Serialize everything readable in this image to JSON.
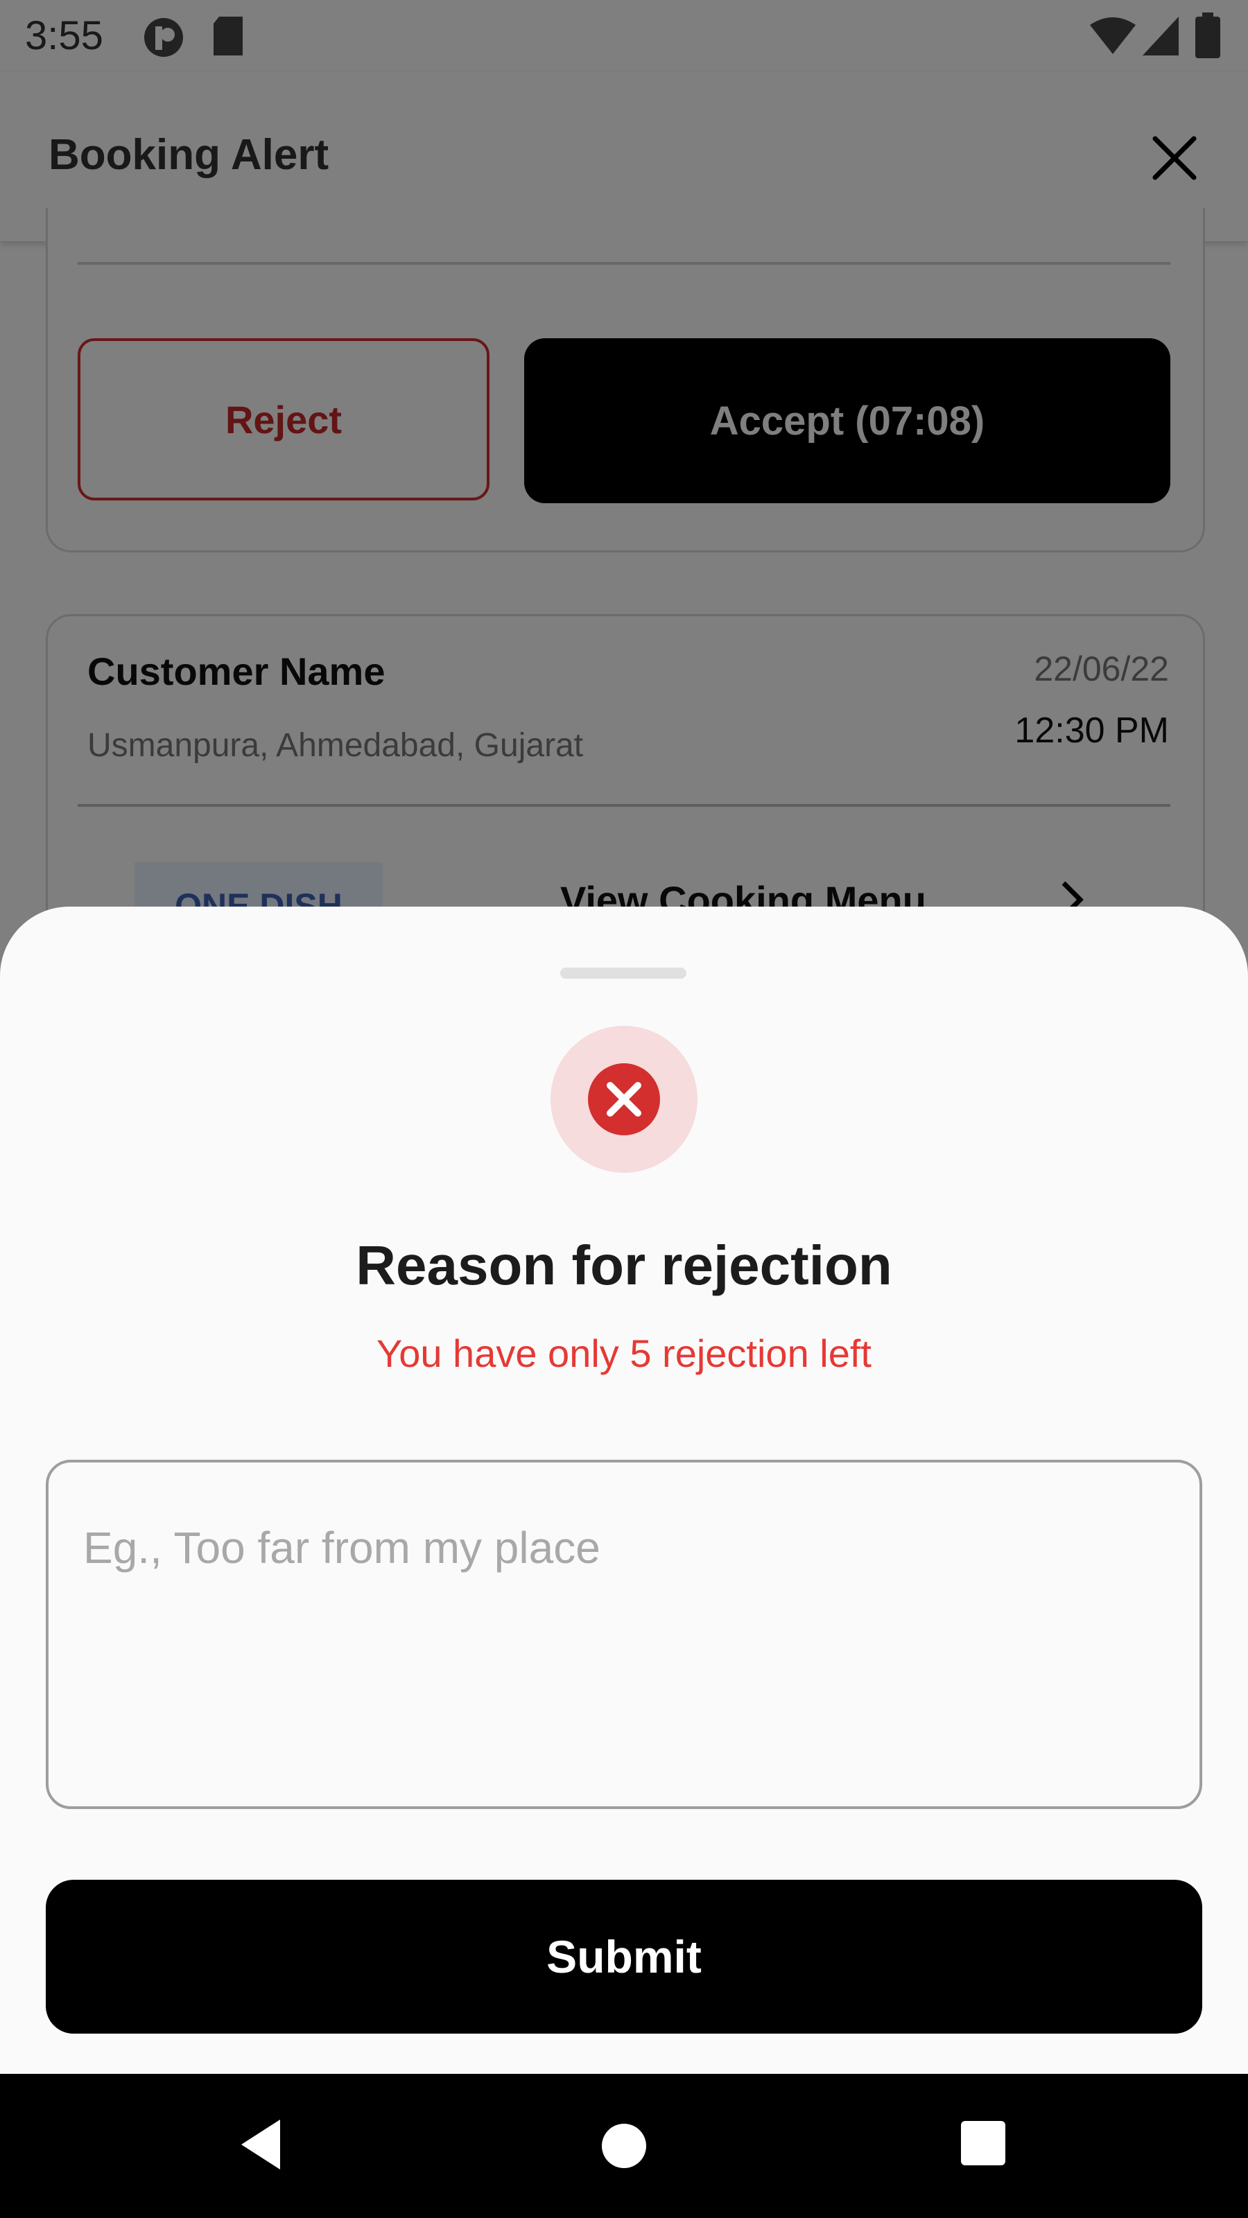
{
  "status_bar": {
    "time": "3:55"
  },
  "app_bar": {
    "title": "Booking Alert"
  },
  "booking_card": {
    "reject_label": "Reject",
    "accept_label": "Accept (07:08)"
  },
  "customer_card": {
    "name": "Customer Name",
    "address": "Usmanpura, Ahmedabad, Gujarat",
    "date": "22/06/22",
    "time": "12:30 PM",
    "badge": "ONE DISH",
    "menu_link": "View Cooking Menu"
  },
  "sheet": {
    "title": "Reason for rejection",
    "subtitle": "You have only 5 rejection left",
    "input_placeholder": "Eg., Too far from my place",
    "input_value": "",
    "submit_label": "Submit"
  },
  "colors": {
    "accent_red": "#e53935",
    "primary_black": "#000000",
    "icon_bg": "#f6dcdc"
  },
  "icons": [
    "close-icon",
    "chevron-right-icon",
    "reject-x-icon",
    "nav-back-icon",
    "nav-home-icon",
    "nav-recents-icon",
    "wifi-icon",
    "signal-icon",
    "battery-icon"
  ]
}
